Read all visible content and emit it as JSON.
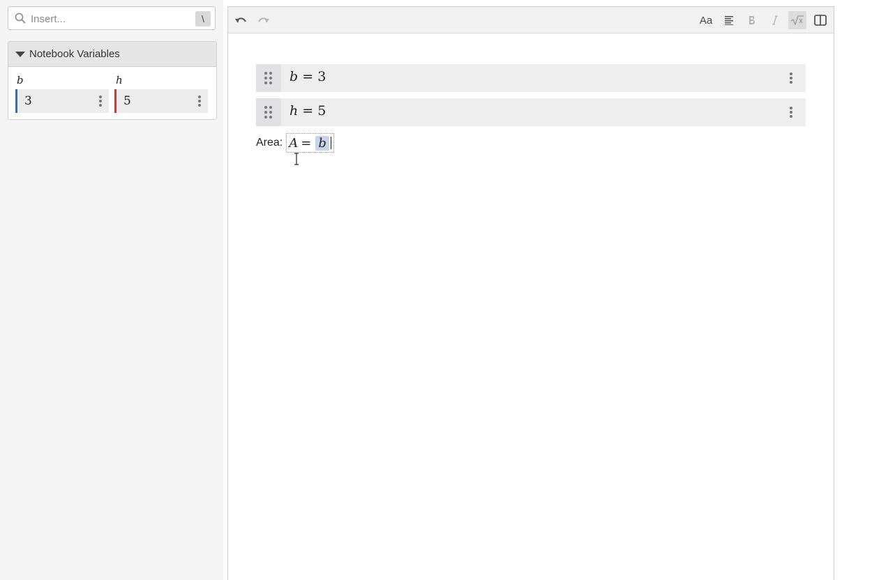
{
  "search": {
    "placeholder": "Insert...",
    "shortcut": "\\"
  },
  "variables_panel": {
    "title": "Notebook Variables",
    "items": [
      {
        "name": "b",
        "value": "3",
        "color": "#3b6ea5"
      },
      {
        "name": "h",
        "value": "5",
        "color": "#b8443e"
      }
    ]
  },
  "toolbar": {
    "font_label": "Aa",
    "icons": [
      "undo-icon",
      "redo-icon",
      "font-icon",
      "align-icon",
      "bold-icon",
      "italic-icon",
      "sqrt-icon",
      "split-view-icon"
    ]
  },
  "rows": [
    {
      "var": "b",
      "equals": "=",
      "value": "3"
    },
    {
      "var": "h",
      "equals": "=",
      "value": "5"
    }
  ],
  "text_line": {
    "label": "Area:",
    "lhs": "A",
    "equals": "=",
    "selection": "b"
  }
}
